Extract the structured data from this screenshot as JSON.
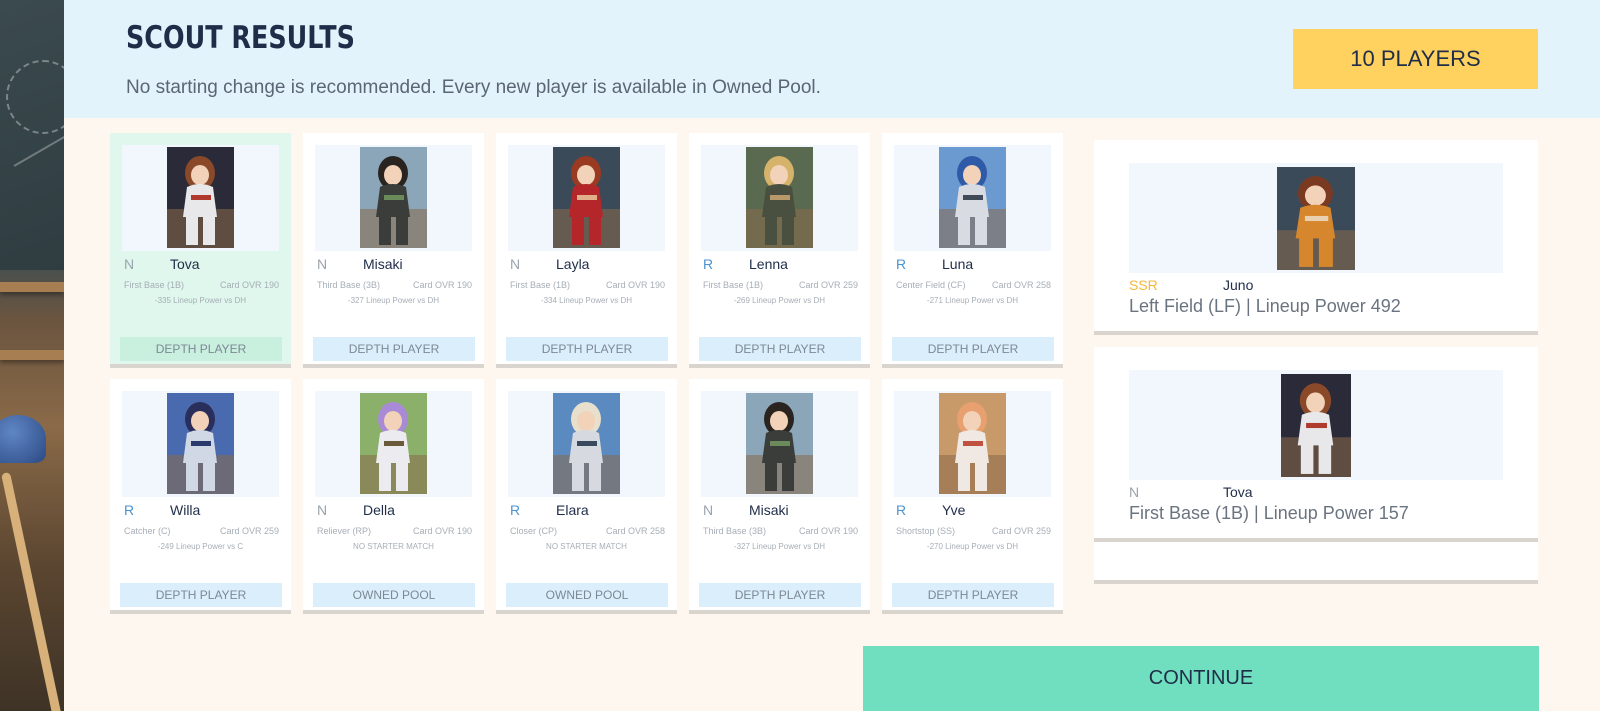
{
  "header": {
    "title": "SCOUT RESULTS",
    "subtitle": "No starting change is recommended. Every new player is available in Owned Pool.",
    "count_label": "10 PLAYERS"
  },
  "cards": [
    {
      "rarity": "N",
      "name": "Tova",
      "position": "First Base (1B)",
      "ovr": "Card OVR 190",
      "note": "-335 Lineup Power vs DH",
      "tag": "DEPTH PLAYER",
      "hair": "#8a4a2a",
      "kit": "#e8e8ea",
      "accent": "#b13a2e",
      "sky": "#2a2a38"
    },
    {
      "rarity": "N",
      "name": "Misaki",
      "position": "Third Base (3B)",
      "ovr": "Card OVR 190",
      "note": "-327 Lineup Power vs DH",
      "tag": "DEPTH PLAYER",
      "hair": "#2a2420",
      "kit": "#3a3d3a",
      "accent": "#6a8a5a",
      "sky": "#8aa6b8"
    },
    {
      "rarity": "N",
      "name": "Layla",
      "position": "First Base (1B)",
      "ovr": "Card OVR 190",
      "note": "-334 Lineup Power vs DH",
      "tag": "DEPTH PLAYER",
      "hair": "#9a3a22",
      "kit": "#b5262a",
      "accent": "#e0b08a",
      "sky": "#3a4a58"
    },
    {
      "rarity": "R",
      "name": "Lenna",
      "position": "First Base (1B)",
      "ovr": "Card OVR 259",
      "note": "-269 Lineup Power vs DH",
      "tag": "DEPTH PLAYER",
      "hair": "#d6b36a",
      "kit": "#4a5040",
      "accent": "#b89a6a",
      "sky": "#5a6a50"
    },
    {
      "rarity": "R",
      "name": "Luna",
      "position": "Center Field (CF)",
      "ovr": "Card OVR 258",
      "note": "-271 Lineup Power vs DH",
      "tag": "DEPTH PLAYER",
      "hair": "#2e5aa8",
      "kit": "#d8dce2",
      "accent": "#404a58",
      "sky": "#6a9ad0"
    },
    {
      "rarity": "R",
      "name": "Willa",
      "position": "Catcher (C)",
      "ovr": "Card OVR 259",
      "note": "-249 Lineup Power vs C",
      "tag": "DEPTH PLAYER",
      "hair": "#2a2e5a",
      "kit": "#d0d8e6",
      "accent": "#2a3a6a",
      "sky": "#4a6ab0"
    },
    {
      "rarity": "N",
      "name": "Della",
      "position": "Reliever (RP)",
      "ovr": "Card OVR 190",
      "note": "NO STARTER MATCH",
      "tag": "OWNED POOL",
      "hair": "#a88ad6",
      "kit": "#ececf0",
      "accent": "#6a5a3a",
      "sky": "#8ab06a"
    },
    {
      "rarity": "R",
      "name": "Elara",
      "position": "Closer (CP)",
      "ovr": "Card OVR 258",
      "note": "NO STARTER MATCH",
      "tag": "OWNED POOL",
      "hair": "#e8e0cc",
      "kit": "#d6dae0",
      "accent": "#3a4a5e",
      "sky": "#5a8ac0"
    },
    {
      "rarity": "N",
      "name": "Misaki",
      "position": "Third Base (3B)",
      "ovr": "Card OVR 190",
      "note": "-327 Lineup Power vs DH",
      "tag": "DEPTH PLAYER",
      "hair": "#2a2420",
      "kit": "#3a3d3a",
      "accent": "#6a8a5a",
      "sky": "#8aa6b8"
    },
    {
      "rarity": "R",
      "name": "Yve",
      "position": "Shortstop (SS)",
      "ovr": "Card OVR 259",
      "note": "-270 Lineup Power vs DH",
      "tag": "DEPTH PLAYER",
      "hair": "#e8a070",
      "kit": "#f0e8e2",
      "accent": "#c05040",
      "sky": "#c89a6a"
    }
  ],
  "featured": [
    {
      "rarity": "SSR",
      "name": "Juno",
      "desc": "Left Field (LF)  |  Lineup Power 492",
      "hair": "#7a3a22",
      "kit": "#d6872e",
      "accent": "#e8d0b0",
      "sky": "#3a4a58"
    },
    {
      "rarity": "N",
      "name": "Tova",
      "desc": "First Base (1B)  |  Lineup Power 157",
      "hair": "#8a4a2a",
      "kit": "#e8e8ea",
      "accent": "#b13a2e",
      "sky": "#2a2a38"
    }
  ],
  "continue_label": "CONTINUE"
}
